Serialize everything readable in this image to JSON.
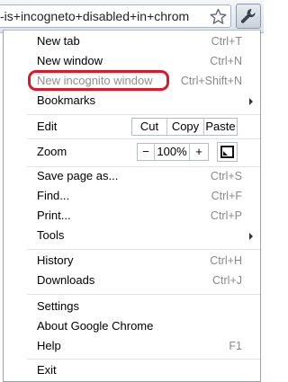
{
  "omnibox": {
    "text": "-is+incogneto+disabled+in+chrom"
  },
  "icons": {
    "star": "star-icon",
    "wrench": "wrench-icon",
    "fullscreen": "fullscreen-icon",
    "submenu": "chevron-right-icon"
  },
  "colors": {
    "highlight": "#e0162b",
    "disabled_text": "#909090",
    "shortcut_text": "#8a8a8a"
  },
  "menu": {
    "new_tab": {
      "label": "New tab",
      "shortcut": "Ctrl+T"
    },
    "new_window": {
      "label": "New window",
      "shortcut": "Ctrl+N"
    },
    "new_incognito": {
      "label": "New incognito window",
      "shortcut": "Ctrl+Shift+N",
      "state": "disabled"
    },
    "bookmarks": {
      "label": "Bookmarks"
    },
    "edit": {
      "label": "Edit",
      "cut": "Cut",
      "copy": "Copy",
      "paste": "Paste"
    },
    "zoom": {
      "label": "Zoom",
      "minus": "−",
      "value": "100%",
      "plus": "+"
    },
    "save_page": {
      "label": "Save page as...",
      "shortcut": "Ctrl+S"
    },
    "find": {
      "label": "Find...",
      "shortcut": "Ctrl+F"
    },
    "print": {
      "label": "Print...",
      "shortcut": "Ctrl+P"
    },
    "tools": {
      "label": "Tools"
    },
    "history": {
      "label": "History",
      "shortcut": "Ctrl+H"
    },
    "downloads": {
      "label": "Downloads",
      "shortcut": "Ctrl+J"
    },
    "settings": {
      "label": "Settings"
    },
    "about": {
      "label": "About Google Chrome"
    },
    "help": {
      "label": "Help",
      "shortcut": "F1"
    },
    "exit": {
      "label": "Exit"
    }
  }
}
